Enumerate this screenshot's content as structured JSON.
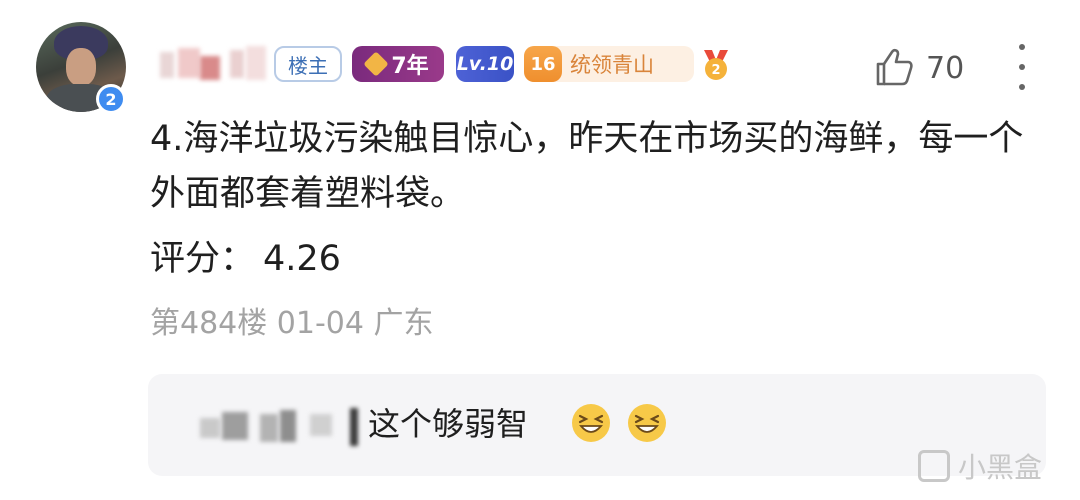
{
  "comment": {
    "avatar_level_badge": "2",
    "tags": {
      "host": "楼主",
      "years": "7年",
      "level": "Lv.10",
      "rank_number": "16",
      "rank_title": "统领青山",
      "medal_number": "2"
    },
    "like_count": "70",
    "content": "4.海洋垃圾污染触目惊心，昨天在市场买的海鲜，每一个外面都套着塑料袋。",
    "score_label": "评分：",
    "score_value": "4.26",
    "meta": "第484楼 01-04 广东",
    "reply": {
      "text": "这个够弱智"
    }
  },
  "watermark": "小黑盒",
  "icons": [
    "thumbs-up-icon",
    "more-vertical-icon",
    "laughing-emoji-icon",
    "gem-icon",
    "medal-icon"
  ],
  "colors": {
    "host_tag": "#3c6fb5",
    "years_tag": "#8a3282",
    "level_tag": "#4a5ed2",
    "rank_tag": "#d9843a",
    "meta_text": "#a3a3a3",
    "reply_bg": "#f5f5f7"
  }
}
